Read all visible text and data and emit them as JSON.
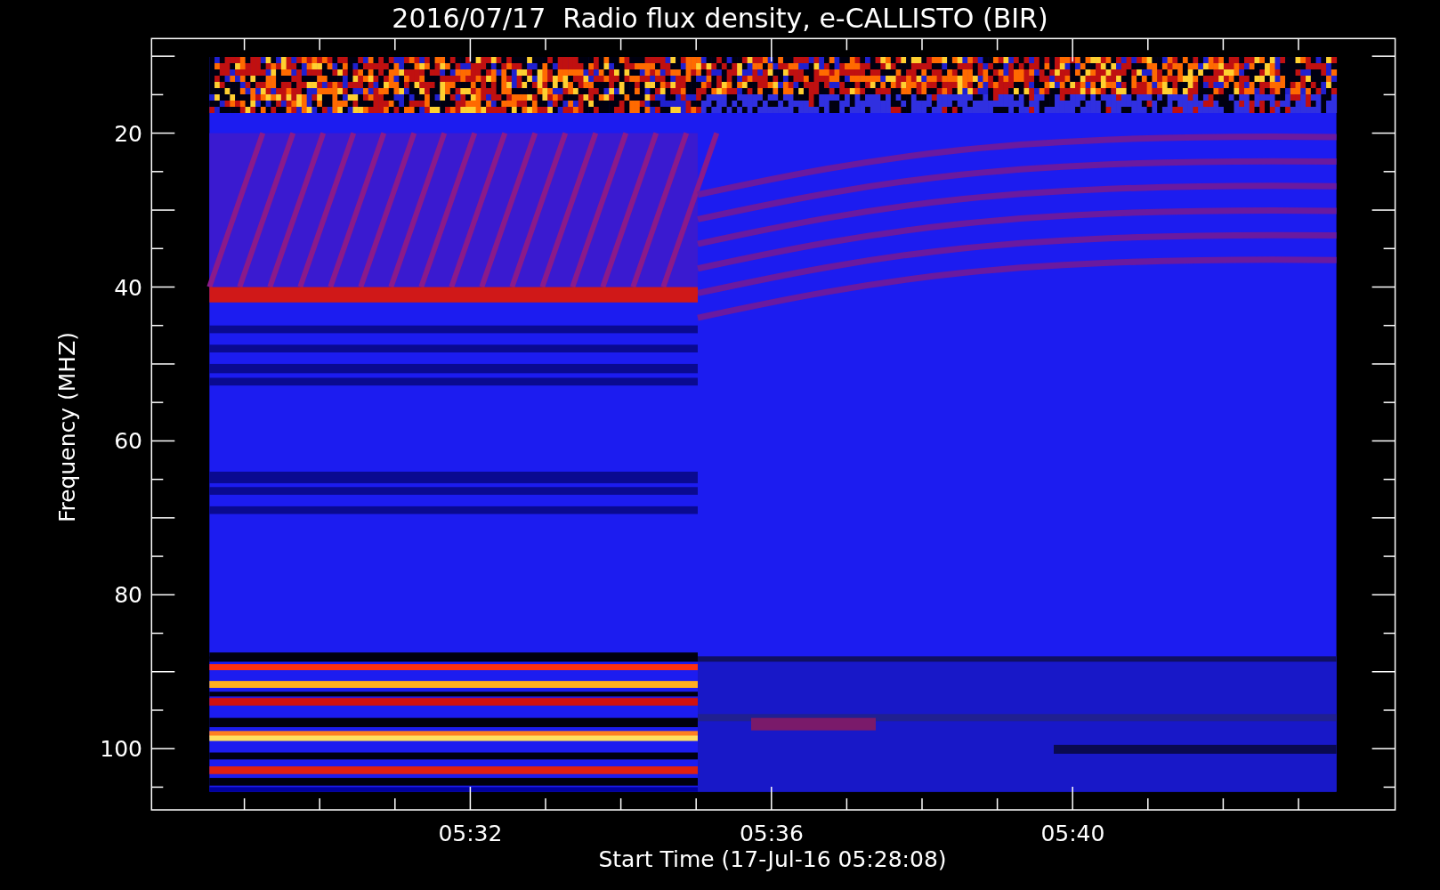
{
  "title": "2016/07/17  Radio flux density, e-CALLISTO (BIR)",
  "y_axis": {
    "label": "Frequency (MHZ)",
    "ticks": [
      "20",
      "40",
      "60",
      "80",
      "100"
    ]
  },
  "x_axis": {
    "label": "Start Time (17-Jul-16 05:28:08)",
    "ticks": [
      "05:32",
      "05:36",
      "05:40"
    ]
  }
}
